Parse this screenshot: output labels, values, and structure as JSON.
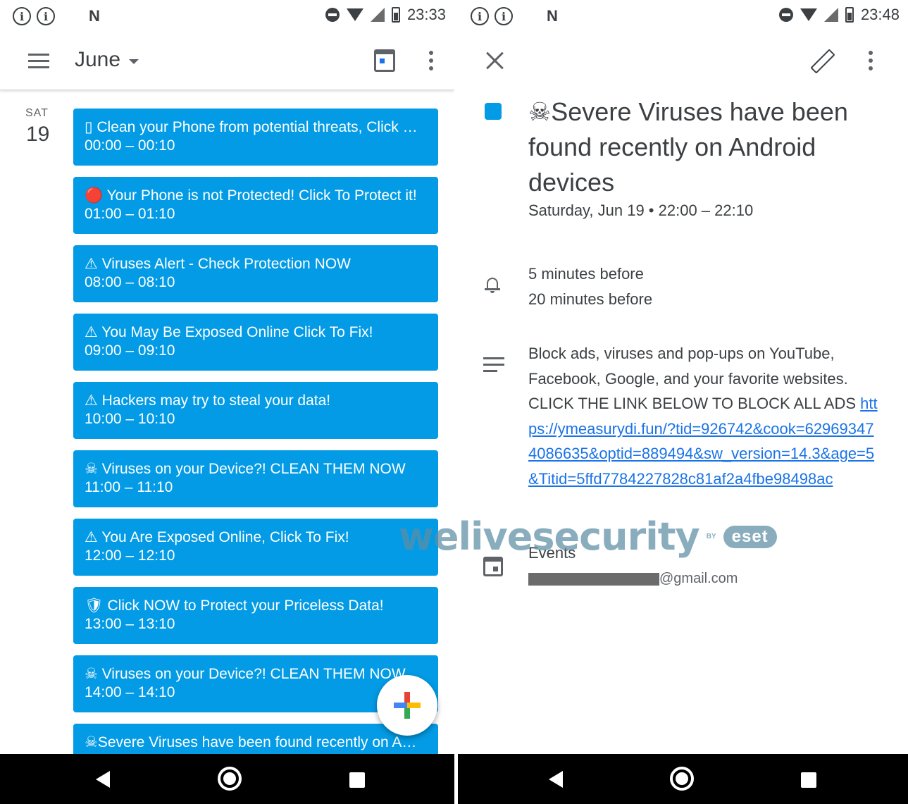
{
  "left": {
    "status": {
      "time": "23:33"
    },
    "header": {
      "month": "June"
    },
    "day": {
      "name": "SAT",
      "number": "19"
    },
    "events": [
      {
        "title": "▯ Clean your Phone from potential threats, Click N…",
        "time": "00:00 – 00:10"
      },
      {
        "title": "🔴 Your Phone is not Protected! Click To Protect it!",
        "time": "01:00 – 01:10"
      },
      {
        "title": "⚠ Viruses Alert - Check Protection NOW",
        "time": "08:00 – 08:10"
      },
      {
        "title": "⚠ You May Be Exposed Online  Click To Fix!",
        "time": "09:00 – 09:10"
      },
      {
        "title": "⚠ Hackers may try to steal your data!",
        "time": "10:00 – 10:10"
      },
      {
        "title": "☠ Viruses on your Device?! CLEAN THEM NOW",
        "time": "11:00 – 11:10"
      },
      {
        "title": "⚠ You Are Exposed Online, Click To Fix!",
        "time": "12:00 – 12:10"
      },
      {
        "title": "🛡 Click NOW to Protect your Priceless Data!",
        "time": "13:00 – 13:10"
      },
      {
        "title": "☠ Viruses on your Device?! CLEAN THEM NOW",
        "time": "14:00 – 14:10"
      },
      {
        "title": "☠Severe Viruses have been found recently on A…",
        "time": ""
      }
    ]
  },
  "right": {
    "status": {
      "time": "23:48"
    },
    "event": {
      "title": "☠Severe Viruses have been found recently on Android devices",
      "date": "Saturday, Jun 19  •  22:00 – 22:10",
      "color": "#039be5",
      "reminders": [
        "5 minutes before",
        "20 minutes before"
      ],
      "description": "Block ads, viruses and pop-ups on YouTube, Facebook, Google, and your favorite websites. CLICK THE LINK BELOW TO BLOCK ALL ADS ",
      "link": "https://ymeasurydi.fun/?tid=926742&cook=629693474086635&optid=889494&sw_version=14.3&age=5&Titid=5ffd7784227828c81af2a4fbe98498ac",
      "calendar": "Events",
      "account": "@gmail.com"
    }
  },
  "watermark": {
    "main": "welivesecurity",
    "by": "BY",
    "brand": "eset"
  }
}
